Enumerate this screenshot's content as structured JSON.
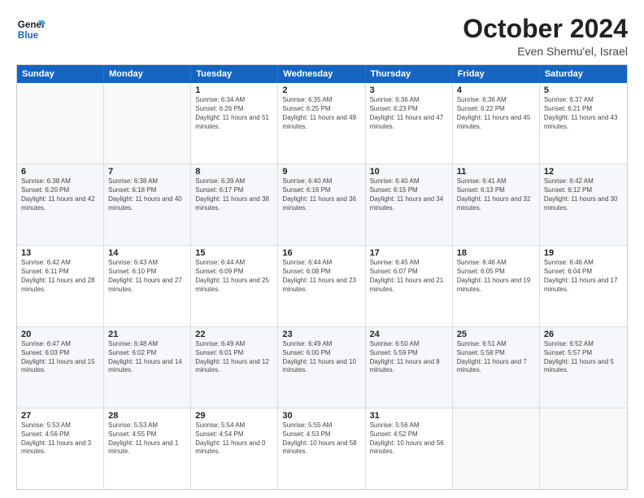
{
  "logo": {
    "line1": "General",
    "line2": "Blue"
  },
  "title": "October 2024",
  "subtitle": "Even Shemu'el, Israel",
  "days_header": [
    "Sunday",
    "Monday",
    "Tuesday",
    "Wednesday",
    "Thursday",
    "Friday",
    "Saturday"
  ],
  "weeks": [
    [
      {
        "day": "",
        "info": ""
      },
      {
        "day": "",
        "info": ""
      },
      {
        "day": "1",
        "info": "Sunrise: 6:34 AM\nSunset: 6:26 PM\nDaylight: 11 hours and 51 minutes."
      },
      {
        "day": "2",
        "info": "Sunrise: 6:35 AM\nSunset: 6:25 PM\nDaylight: 11 hours and 49 minutes."
      },
      {
        "day": "3",
        "info": "Sunrise: 6:36 AM\nSunset: 6:23 PM\nDaylight: 11 hours and 47 minutes."
      },
      {
        "day": "4",
        "info": "Sunrise: 6:36 AM\nSunset: 6:22 PM\nDaylight: 11 hours and 45 minutes."
      },
      {
        "day": "5",
        "info": "Sunrise: 6:37 AM\nSunset: 6:21 PM\nDaylight: 11 hours and 43 minutes."
      }
    ],
    [
      {
        "day": "6",
        "info": "Sunrise: 6:38 AM\nSunset: 6:20 PM\nDaylight: 11 hours and 42 minutes."
      },
      {
        "day": "7",
        "info": "Sunrise: 6:38 AM\nSunset: 6:18 PM\nDaylight: 11 hours and 40 minutes."
      },
      {
        "day": "8",
        "info": "Sunrise: 6:39 AM\nSunset: 6:17 PM\nDaylight: 11 hours and 38 minutes."
      },
      {
        "day": "9",
        "info": "Sunrise: 6:40 AM\nSunset: 6:16 PM\nDaylight: 11 hours and 36 minutes."
      },
      {
        "day": "10",
        "info": "Sunrise: 6:40 AM\nSunset: 6:15 PM\nDaylight: 11 hours and 34 minutes."
      },
      {
        "day": "11",
        "info": "Sunrise: 6:41 AM\nSunset: 6:13 PM\nDaylight: 11 hours and 32 minutes."
      },
      {
        "day": "12",
        "info": "Sunrise: 6:42 AM\nSunset: 6:12 PM\nDaylight: 11 hours and 30 minutes."
      }
    ],
    [
      {
        "day": "13",
        "info": "Sunrise: 6:42 AM\nSunset: 6:11 PM\nDaylight: 11 hours and 28 minutes."
      },
      {
        "day": "14",
        "info": "Sunrise: 6:43 AM\nSunset: 6:10 PM\nDaylight: 11 hours and 27 minutes."
      },
      {
        "day": "15",
        "info": "Sunrise: 6:44 AM\nSunset: 6:09 PM\nDaylight: 11 hours and 25 minutes."
      },
      {
        "day": "16",
        "info": "Sunrise: 6:44 AM\nSunset: 6:08 PM\nDaylight: 11 hours and 23 minutes."
      },
      {
        "day": "17",
        "info": "Sunrise: 6:45 AM\nSunset: 6:07 PM\nDaylight: 11 hours and 21 minutes."
      },
      {
        "day": "18",
        "info": "Sunrise: 6:46 AM\nSunset: 6:05 PM\nDaylight: 11 hours and 19 minutes."
      },
      {
        "day": "19",
        "info": "Sunrise: 6:46 AM\nSunset: 6:04 PM\nDaylight: 11 hours and 17 minutes."
      }
    ],
    [
      {
        "day": "20",
        "info": "Sunrise: 6:47 AM\nSunset: 6:03 PM\nDaylight: 11 hours and 15 minutes."
      },
      {
        "day": "21",
        "info": "Sunrise: 6:48 AM\nSunset: 6:02 PM\nDaylight: 11 hours and 14 minutes."
      },
      {
        "day": "22",
        "info": "Sunrise: 6:49 AM\nSunset: 6:01 PM\nDaylight: 11 hours and 12 minutes."
      },
      {
        "day": "23",
        "info": "Sunrise: 6:49 AM\nSunset: 6:00 PM\nDaylight: 11 hours and 10 minutes."
      },
      {
        "day": "24",
        "info": "Sunrise: 6:50 AM\nSunset: 5:59 PM\nDaylight: 11 hours and 8 minutes."
      },
      {
        "day": "25",
        "info": "Sunrise: 6:51 AM\nSunset: 5:58 PM\nDaylight: 11 hours and 7 minutes."
      },
      {
        "day": "26",
        "info": "Sunrise: 6:52 AM\nSunset: 5:57 PM\nDaylight: 11 hours and 5 minutes."
      }
    ],
    [
      {
        "day": "27",
        "info": "Sunrise: 5:53 AM\nSunset: 4:56 PM\nDaylight: 11 hours and 3 minutes."
      },
      {
        "day": "28",
        "info": "Sunrise: 5:53 AM\nSunset: 4:55 PM\nDaylight: 11 hours and 1 minute."
      },
      {
        "day": "29",
        "info": "Sunrise: 5:54 AM\nSunset: 4:54 PM\nDaylight: 11 hours and 0 minutes."
      },
      {
        "day": "30",
        "info": "Sunrise: 5:55 AM\nSunset: 4:53 PM\nDaylight: 10 hours and 58 minutes."
      },
      {
        "day": "31",
        "info": "Sunrise: 5:56 AM\nSunset: 4:52 PM\nDaylight: 10 hours and 56 minutes."
      },
      {
        "day": "",
        "info": ""
      },
      {
        "day": "",
        "info": ""
      }
    ]
  ]
}
